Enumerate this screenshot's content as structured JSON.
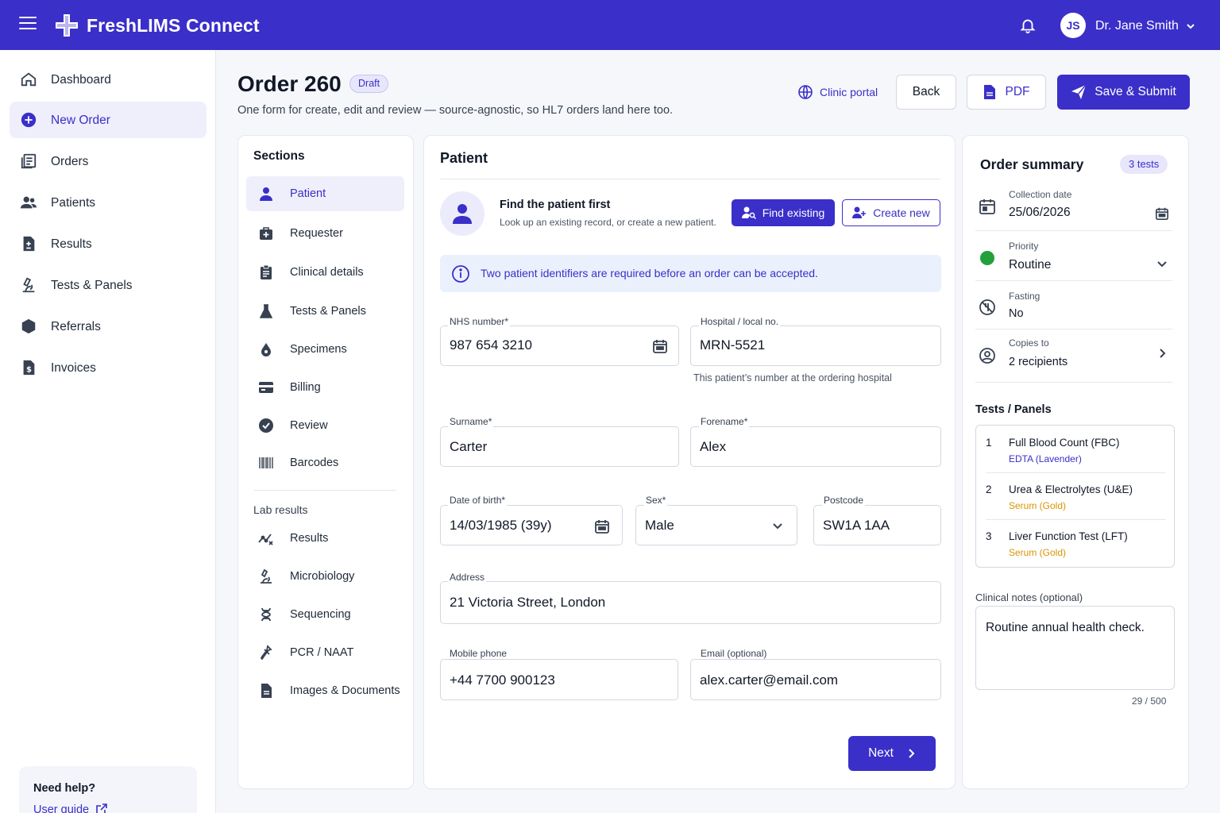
{
  "app": {
    "name": "FreshLIMS Connect"
  },
  "user": {
    "initials": "JS",
    "name": "Dr. Jane Smith"
  },
  "colors": {
    "brand": "#3a2fc9",
    "priority_routine": "#22a03c",
    "edta": "#3a2fc9",
    "serum": "#d99400"
  },
  "sidebar": {
    "items": [
      {
        "label": "Dashboard",
        "icon": "home-icon"
      },
      {
        "label": "New Order",
        "icon": "plus-circle-icon",
        "active": true
      },
      {
        "label": "Orders",
        "icon": "orders-icon"
      },
      {
        "label": "Patients",
        "icon": "users-icon"
      },
      {
        "label": "Results",
        "icon": "results-icon"
      },
      {
        "label": "Tests & Panels",
        "icon": "microscope-icon"
      },
      {
        "label": "Referrals",
        "icon": "referral-icon"
      },
      {
        "label": "Invoices",
        "icon": "invoice-icon"
      }
    ],
    "help": {
      "title": "Need help?",
      "link": "User guide"
    }
  },
  "header": {
    "title": "Order 260",
    "badge": "Draft",
    "subtitle": "One form for create, edit and review — source-agnostic, so HL7 orders land here too.",
    "portal": "Clinic portal",
    "back": "Back",
    "pdf": "PDF",
    "save": "Save & Submit"
  },
  "sections": {
    "title": "Sections",
    "items": [
      {
        "label": "Patient",
        "icon": "person-icon",
        "active": true
      },
      {
        "label": "Requester",
        "icon": "medical-bag-icon"
      },
      {
        "label": "Clinical details",
        "icon": "clipboard-icon"
      },
      {
        "label": "Tests & Panels",
        "icon": "flask-icon"
      },
      {
        "label": "Specimens",
        "icon": "drop-icon"
      },
      {
        "label": "Billing",
        "icon": "card-icon"
      },
      {
        "label": "Review",
        "icon": "check-circle-icon"
      },
      {
        "label": "Barcodes",
        "icon": "barcode-icon"
      }
    ],
    "lab_title": "Lab results",
    "lab_items": [
      {
        "label": "Results",
        "icon": "trend-icon"
      },
      {
        "label": "Microbiology",
        "icon": "microscope-icon"
      },
      {
        "label": "Sequencing",
        "icon": "dna-icon"
      },
      {
        "label": "PCR / NAAT",
        "icon": "pipette-icon"
      },
      {
        "label": "Images & Documents",
        "icon": "document-icon"
      }
    ]
  },
  "patient": {
    "title": "Patient",
    "find_title": "Find the patient first",
    "find_sub": "Look up an existing record, or create a new patient.",
    "find_existing": "Find existing",
    "create_new": "Create new",
    "info": "Two patient identifiers are required before an order can be accepted.",
    "nhs": {
      "label": "NHS number*",
      "value": "987 654 3210"
    },
    "hospital": {
      "label": "Hospital / local no.",
      "value": "MRN-5521",
      "hint": "This patient’s number at the ordering hospital"
    },
    "surname": {
      "label": "Surname*",
      "value": "Carter"
    },
    "forename": {
      "label": "Forename*",
      "value": "Alex"
    },
    "dob": {
      "label": "Date of birth*",
      "value": "14/03/1985 (39y)"
    },
    "sex": {
      "label": "Sex*",
      "value": "Male"
    },
    "postcode": {
      "label": "Postcode",
      "value": "SW1A 1AA"
    },
    "address": {
      "label": "Address",
      "value": "21 Victoria Street, London"
    },
    "mobile": {
      "label": "Mobile phone",
      "value": "+44 7700 900123"
    },
    "email": {
      "label": "Email (optional)",
      "value": "alex.carter@email.com"
    },
    "next": "Next"
  },
  "summary": {
    "title": "Order summary",
    "badge": "3 tests",
    "collection": {
      "label": "Collection date",
      "value": "25/06/2026"
    },
    "priority": {
      "label": "Priority",
      "value": "Routine"
    },
    "fasting": {
      "label": "Fasting",
      "value": "No"
    },
    "copies": {
      "label": "Copies to",
      "value": "2 recipients"
    },
    "tests_title": "Tests / Panels",
    "tests": [
      {
        "num": "1",
        "name": "Full Blood Count (FBC)",
        "tube": "EDTA (Lavender)"
      },
      {
        "num": "2",
        "name": "Urea & Electrolytes (U&E)",
        "tube": "Serum (Gold)"
      },
      {
        "num": "3",
        "name": "Liver Function Test (LFT)",
        "tube": "Serum (Gold)"
      }
    ],
    "notes_label": "Clinical notes (optional)",
    "notes": "Routine annual health check.",
    "notes_count": "29 / 500"
  }
}
